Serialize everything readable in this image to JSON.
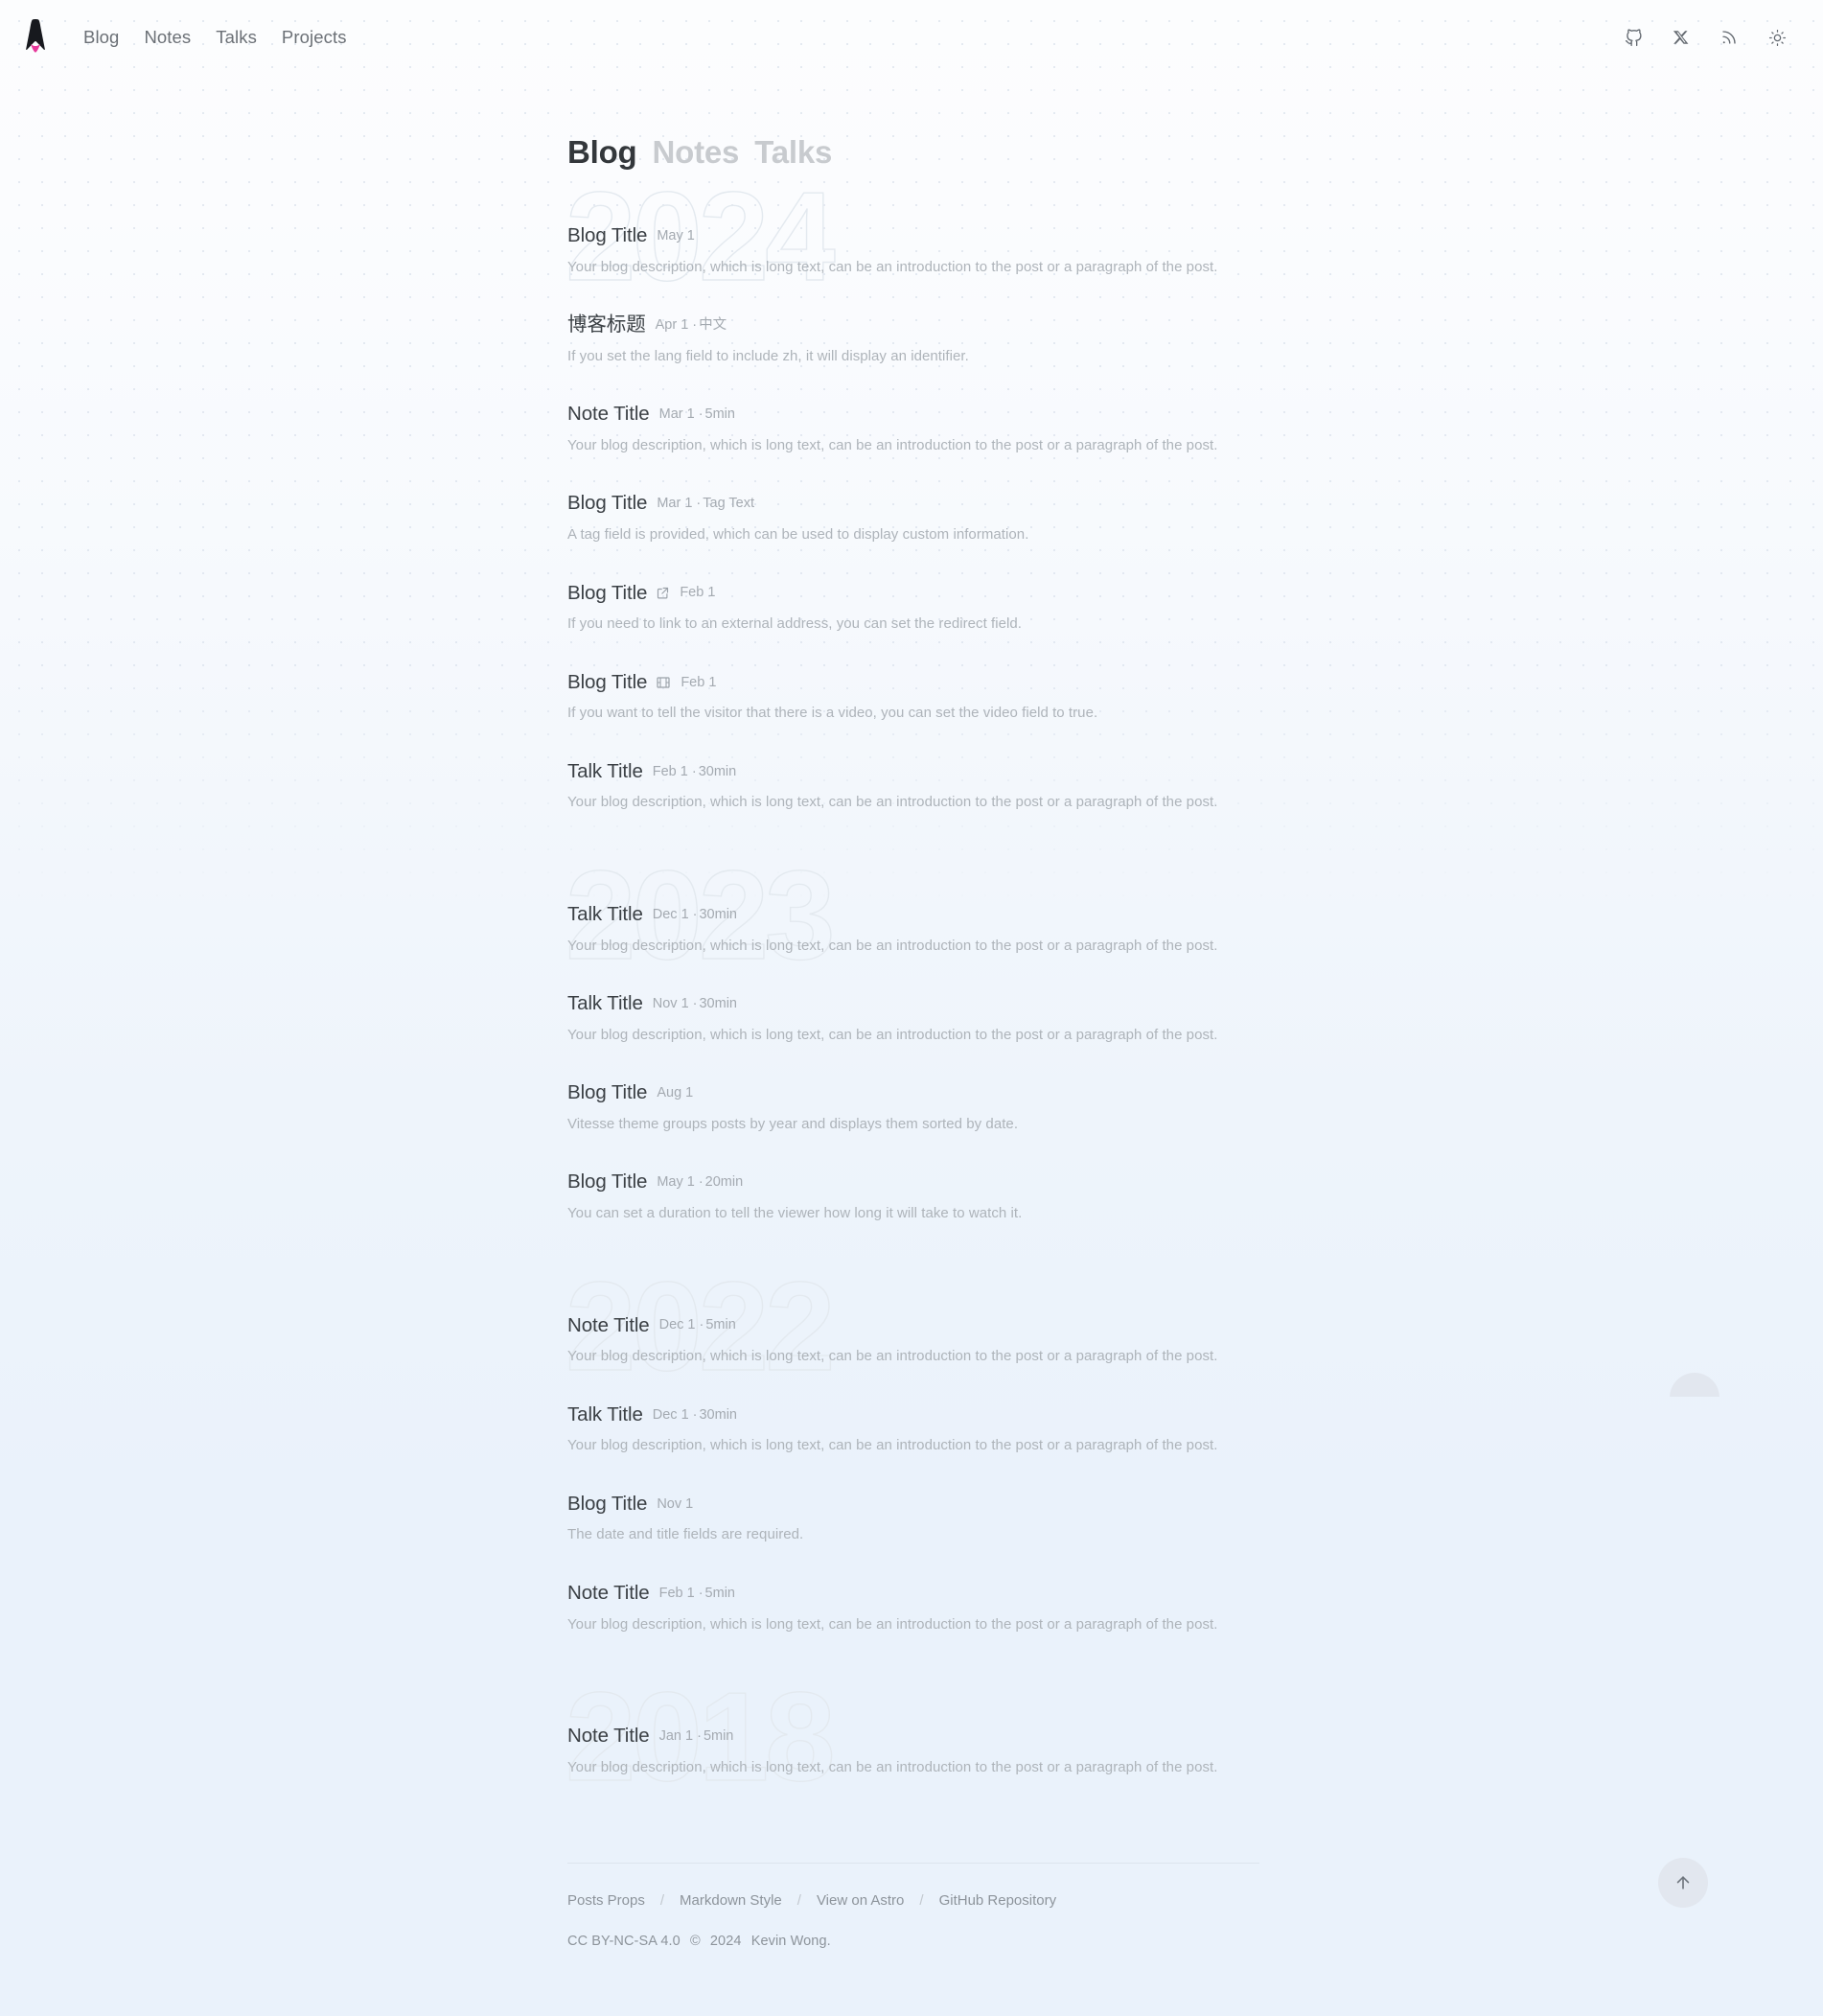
{
  "header": {
    "logo_name": "astro-logo",
    "nav": [
      {
        "label": "Blog"
      },
      {
        "label": "Notes"
      },
      {
        "label": "Talks"
      },
      {
        "label": "Projects"
      }
    ],
    "icons": [
      {
        "name": "github-icon",
        "title": "GitHub"
      },
      {
        "name": "x-twitter-icon",
        "title": "X"
      },
      {
        "name": "rss-icon",
        "title": "RSS"
      },
      {
        "name": "sun-icon",
        "title": "Toggle theme"
      }
    ]
  },
  "page_tabs": [
    {
      "label": "Blog",
      "state": "active"
    },
    {
      "label": "Notes",
      "state": "inactive"
    },
    {
      "label": "Talks",
      "state": "inactive"
    }
  ],
  "years": [
    {
      "year": "2024",
      "posts": [
        {
          "title": "Blog Title",
          "date": "May 1",
          "extra": "",
          "icon": "",
          "description": "Your blog description, which is long text, can be an introduction to the post or a paragraph of the post."
        },
        {
          "title": "博客标题",
          "date": "Apr 1",
          "extra": "中文",
          "icon": "",
          "description": "If you set the lang field to include zh, it will display an identifier."
        },
        {
          "title": "Note Title",
          "date": "Mar 1",
          "extra": "5min",
          "icon": "",
          "description": "Your blog description, which is long text, can be an introduction to the post or a paragraph of the post."
        },
        {
          "title": "Blog Title",
          "date": "Mar 1",
          "extra": "Tag Text",
          "icon": "",
          "description": "A tag field is provided, which can be used to display custom information."
        },
        {
          "title": "Blog Title",
          "date": "Feb 1",
          "extra": "",
          "icon": "external-link-icon",
          "description": "If you need to link to an external address, you can set the redirect field."
        },
        {
          "title": "Blog Title",
          "date": "Feb 1",
          "extra": "",
          "icon": "video-film-icon",
          "description": "If you want to tell the visitor that there is a video, you can set the video field to true."
        },
        {
          "title": "Talk Title",
          "date": "Feb 1",
          "extra": "30min",
          "icon": "",
          "description": "Your blog description, which is long text, can be an introduction to the post or a paragraph of the post."
        }
      ]
    },
    {
      "year": "2023",
      "posts": [
        {
          "title": "Talk Title",
          "date": "Dec 1",
          "extra": "30min",
          "icon": "",
          "description": "Your blog description, which is long text, can be an introduction to the post or a paragraph of the post."
        },
        {
          "title": "Talk Title",
          "date": "Nov 1",
          "extra": "30min",
          "icon": "",
          "description": "Your blog description, which is long text, can be an introduction to the post or a paragraph of the post."
        },
        {
          "title": "Blog Title",
          "date": "Aug 1",
          "extra": "",
          "icon": "",
          "description": "Vitesse theme groups posts by year and displays them sorted by date."
        },
        {
          "title": "Blog Title",
          "date": "May 1",
          "extra": "20min",
          "icon": "",
          "description": "You can set a duration to tell the viewer how long it will take to watch it."
        }
      ]
    },
    {
      "year": "2022",
      "posts": [
        {
          "title": "Note Title",
          "date": "Dec 1",
          "extra": "5min",
          "icon": "",
          "description": "Your blog description, which is long text, can be an introduction to the post or a paragraph of the post."
        },
        {
          "title": "Talk Title",
          "date": "Dec 1",
          "extra": "30min",
          "icon": "",
          "description": "Your blog description, which is long text, can be an introduction to the post or a paragraph of the post."
        },
        {
          "title": "Blog Title",
          "date": "Nov 1",
          "extra": "",
          "icon": "",
          "description": "The date and title fields are required."
        },
        {
          "title": "Note Title",
          "date": "Feb 1",
          "extra": "5min",
          "icon": "",
          "description": "Your blog description, which is long text, can be an introduction to the post or a paragraph of the post."
        }
      ]
    },
    {
      "year": "2018",
      "posts": [
        {
          "title": "Note Title",
          "date": "Jan 1",
          "extra": "5min",
          "icon": "",
          "description": "Your blog description, which is long text, can be an introduction to the post or a paragraph of the post."
        }
      ]
    }
  ],
  "footer": {
    "links": [
      {
        "label": "Posts Props"
      },
      {
        "label": "Markdown Style"
      },
      {
        "label": "View on Astro"
      },
      {
        "label": "GitHub Repository"
      }
    ],
    "separator": "/",
    "license": "CC BY-NC-SA 4.0",
    "copyright_symbol": "©",
    "year": "2024",
    "author": "Kevin Wong."
  },
  "controls": {
    "scroll_top_name": "arrow-up-icon"
  },
  "colors": {
    "accent_pink": "#e6399b",
    "logo_dark": "#17191e",
    "text_primary": "#3b4045",
    "text_muted": "#aeb4ba",
    "bg_top": "#fcfdfe",
    "bg_bottom": "#eaf2fb",
    "year_outline": "#e3e9ef"
  }
}
